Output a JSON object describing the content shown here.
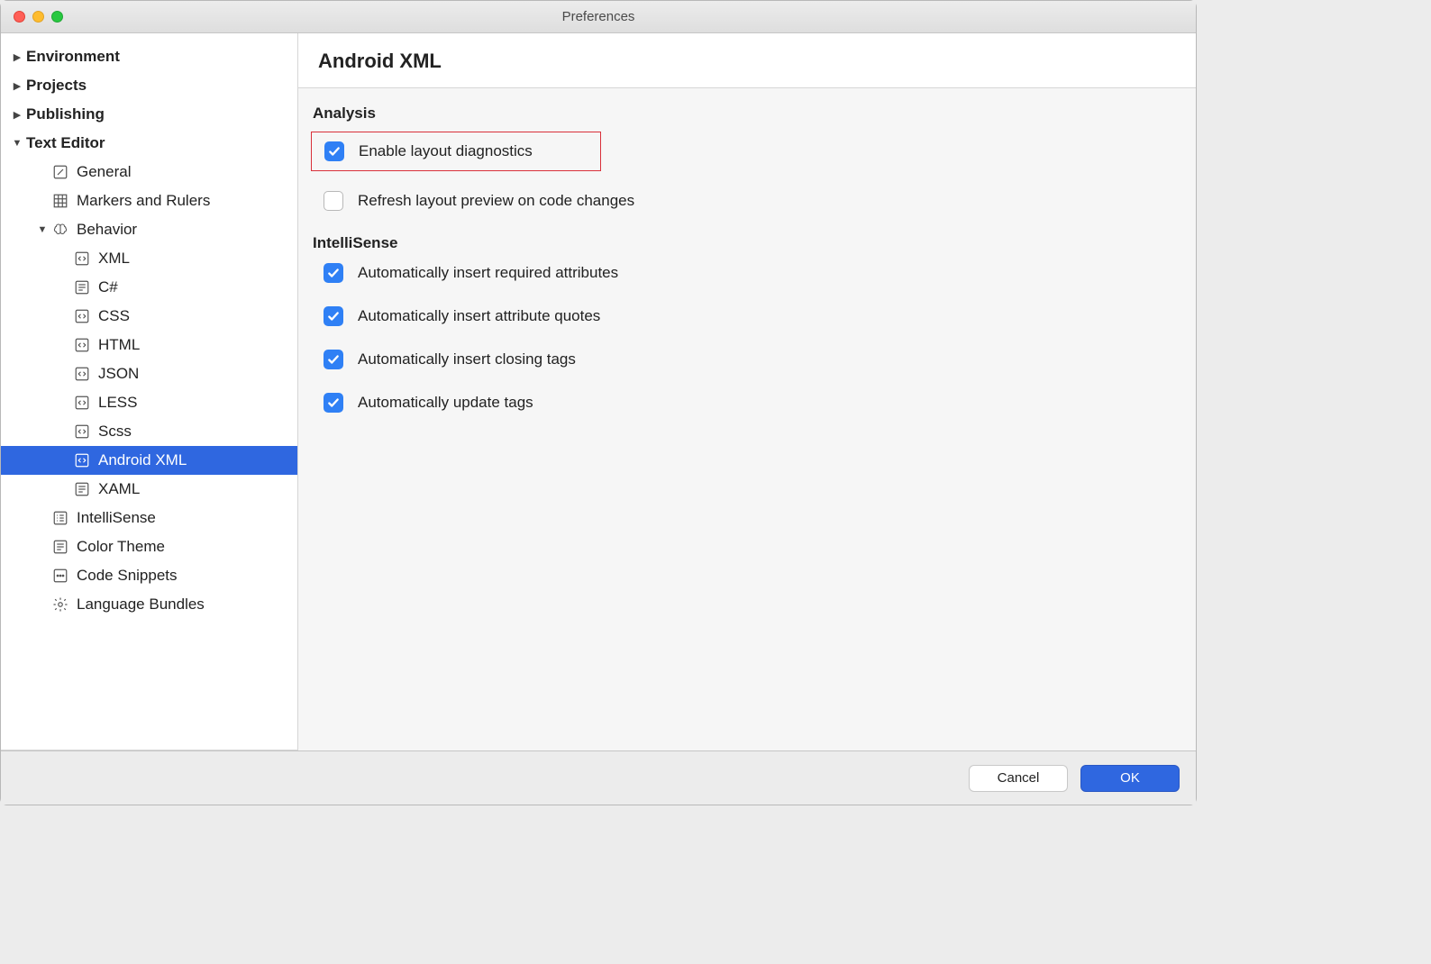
{
  "window": {
    "title": "Preferences"
  },
  "sidebar": {
    "items": [
      {
        "label": "Environment",
        "bold": true,
        "arrow": "right",
        "indent": 0
      },
      {
        "label": "Projects",
        "bold": true,
        "arrow": "right",
        "indent": 0
      },
      {
        "label": "Publishing",
        "bold": true,
        "arrow": "right",
        "indent": 0
      },
      {
        "label": "Text Editor",
        "bold": true,
        "arrow": "down",
        "indent": 0
      },
      {
        "label": "General",
        "icon": "pencil-icon",
        "indent": 1
      },
      {
        "label": "Markers and Rulers",
        "icon": "grid-icon",
        "indent": 1
      },
      {
        "label": "Behavior",
        "icon": "brain-icon",
        "arrow": "down",
        "indent": 1
      },
      {
        "label": "XML",
        "icon": "code-icon",
        "indent": 2
      },
      {
        "label": "C#",
        "icon": "file-icon",
        "indent": 2
      },
      {
        "label": "CSS",
        "icon": "code-icon",
        "indent": 2
      },
      {
        "label": "HTML",
        "icon": "code-icon",
        "indent": 2
      },
      {
        "label": "JSON",
        "icon": "code-icon",
        "indent": 2
      },
      {
        "label": "LESS",
        "icon": "code-icon",
        "indent": 2
      },
      {
        "label": "Scss",
        "icon": "code-icon",
        "indent": 2
      },
      {
        "label": "Android XML",
        "icon": "code-icon",
        "indent": 2,
        "selected": true
      },
      {
        "label": "XAML",
        "icon": "file-icon",
        "indent": 2
      },
      {
        "label": "IntelliSense",
        "icon": "list-icon",
        "indent": 1
      },
      {
        "label": "Color Theme",
        "icon": "file-icon",
        "indent": 1
      },
      {
        "label": "Code Snippets",
        "icon": "dots-icon",
        "indent": 1
      },
      {
        "label": "Language Bundles",
        "icon": "gear-icon",
        "indent": 1
      }
    ]
  },
  "main": {
    "title": "Android XML",
    "sections": {
      "analysis": {
        "title": "Analysis",
        "enable_diag": {
          "label": "Enable layout diagnostics",
          "checked": true
        },
        "refresh_preview": {
          "label": "Refresh layout preview on code changes",
          "checked": false
        }
      },
      "intellisense": {
        "title": "IntelliSense",
        "req_attrs": {
          "label": "Automatically insert required attributes",
          "checked": true
        },
        "attr_quotes": {
          "label": "Automatically insert attribute quotes",
          "checked": true
        },
        "closing_tags": {
          "label": "Automatically insert closing tags",
          "checked": true
        },
        "update_tags": {
          "label": "Automatically update tags",
          "checked": true
        }
      }
    }
  },
  "footer": {
    "cancel": "Cancel",
    "ok": "OK"
  }
}
